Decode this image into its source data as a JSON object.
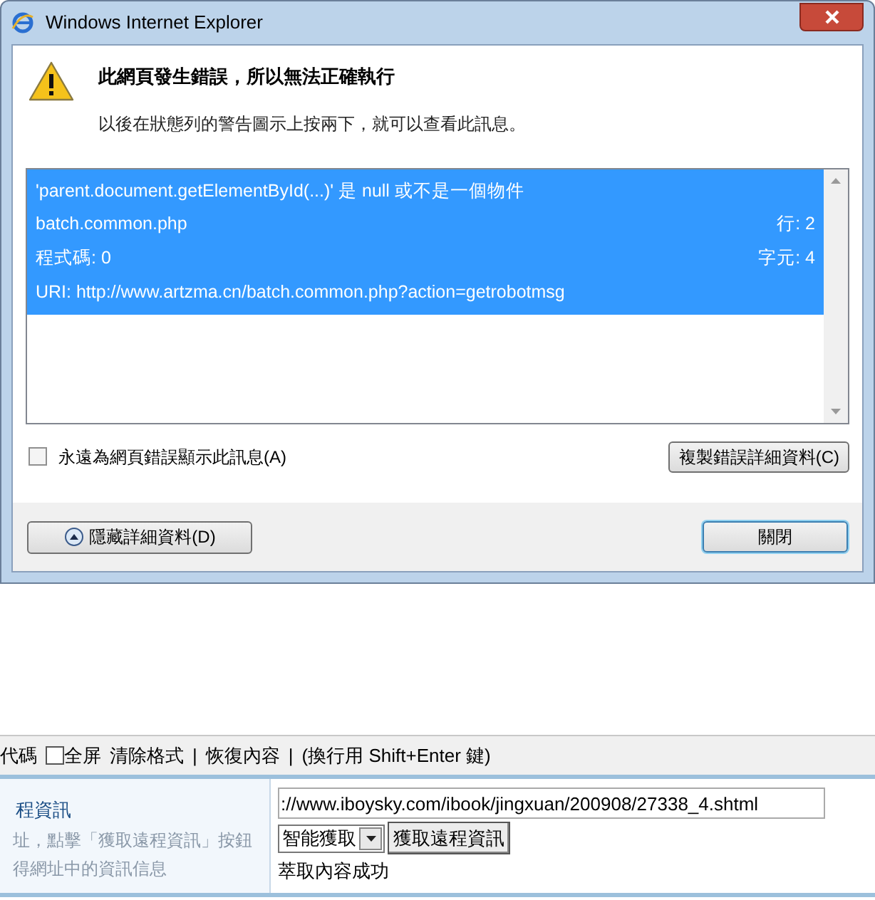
{
  "dialog": {
    "title": "Windows Internet Explorer",
    "heading": "此網頁發生錯誤，所以無法正確執行",
    "message": "以後在狀態列的警告圖示上按兩下，就可以查看此訊息。",
    "error": {
      "selected": true,
      "lines": [
        {
          "left": "'parent.document.getElementById(...)' 是 null 或不是一個物件"
        },
        {
          "left": "batch.common.php",
          "right": "行: 2"
        },
        {
          "left": "程式碼: 0",
          "right": "字元: 4"
        },
        {
          "left": "URI: http://www.artzma.cn/batch.common.php?action=getrobotmsg"
        }
      ]
    },
    "always_show": {
      "label": "永遠為網頁錯誤顯示此訊息(A)",
      "checked": false
    },
    "copy_button": "複製錯誤詳細資料(C)",
    "details_button": "隱藏詳細資料(D)",
    "close_button": "關閉"
  },
  "toolbar": {
    "code": "代碼",
    "fullscreen": {
      "label": "全屏",
      "checked": false
    },
    "items": [
      "清除格式",
      "|",
      "恢復內容",
      "|",
      "(換行用 Shift+Enter 鍵)"
    ]
  },
  "form_row": {
    "title": "程資訊",
    "hint_lines": [
      "址，點擊「獲取遠程資訊」按鈕",
      "得網址中的資訊信息"
    ],
    "url_value": "://www.iboysky.com/ibook/jingxuan/200908/27338_4.shtml",
    "mode": "智能獲取",
    "fetch_button": "獲取遠程資訊",
    "status": "萃取內容成功"
  }
}
